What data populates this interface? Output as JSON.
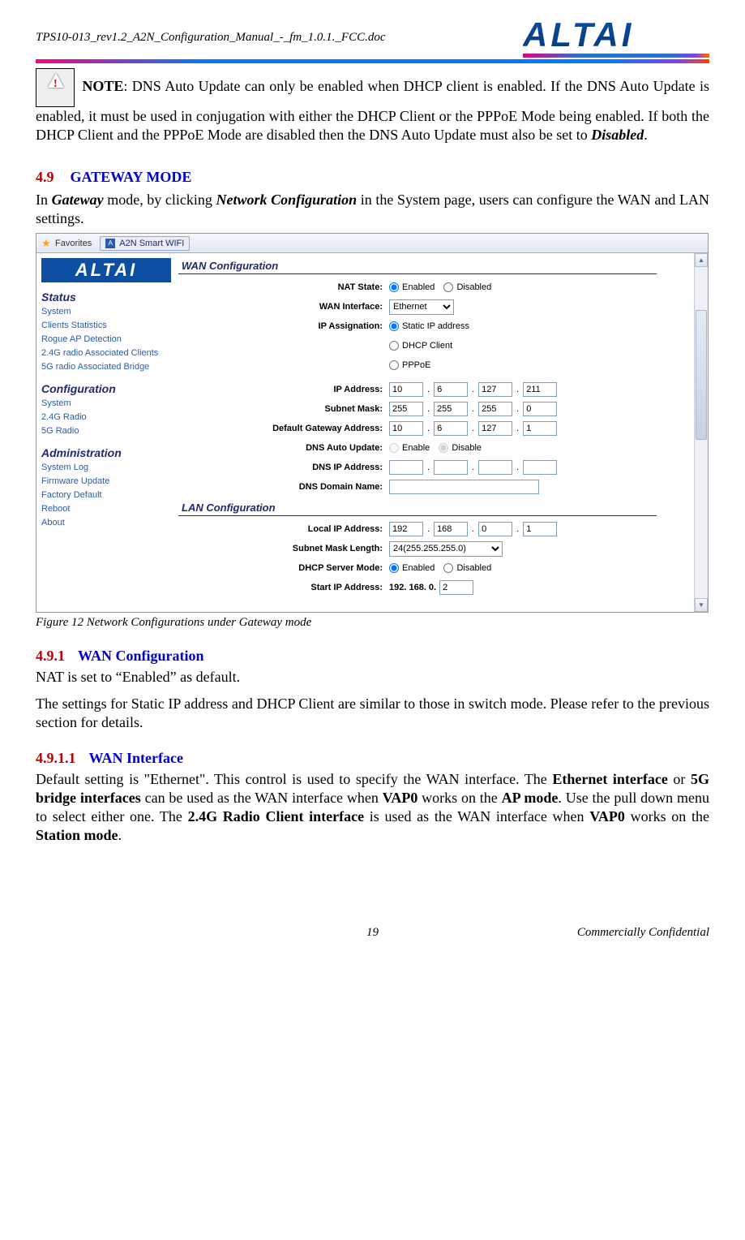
{
  "header": {
    "doc_id": "TPS10-013_rev1.2_A2N_Configuration_Manual_-_fm_1.0.1._FCC.doc",
    "logo_text": "ALTAI"
  },
  "note": {
    "label": "NOTE",
    "text1": ": DNS Auto Update can only be enabled when DHCP client is enabled. If the DNS Auto Update is enabled, it must be used in conjugation with either the DHCP Client or the PPPoE Mode being enabled. If both the DHCP Client and the PPPoE Mode are disabled then the DNS Auto Update must also be set to ",
    "disabled_word": "Disabled",
    "period": "."
  },
  "sec49": {
    "num": "4.9",
    "title": "GATEWAY MODE",
    "intro_a": "In ",
    "intro_b": "Gateway",
    "intro_c": " mode, by clicking ",
    "intro_d": "Network Configuration",
    "intro_e": " in the System page, users can configure the WAN and LAN settings."
  },
  "screenshot": {
    "favorites": "Favorites",
    "tab_title": "A2N Smart WIFI",
    "logo": "ALTAI",
    "sidebar": {
      "status_head": "Status",
      "status_items": [
        "System",
        "Clients Statistics",
        "Rogue AP Detection",
        "2.4G radio Associated Clients",
        "5G radio Associated Bridge"
      ],
      "config_head": "Configuration",
      "config_items": [
        "System",
        "2.4G Radio",
        "5G Radio"
      ],
      "admin_head": "Administration",
      "admin_items": [
        "System Log",
        "Firmware Update",
        "Factory Default",
        "Reboot",
        "About"
      ]
    },
    "wan": {
      "heading": "WAN Configuration",
      "nat_label": "NAT State:",
      "nat_enabled": "Enabled",
      "nat_disabled": "Disabled",
      "wan_if_label": "WAN Interface:",
      "wan_if_value": "Ethernet",
      "ip_assign_label": "IP Assignation:",
      "ip_opt1": "Static IP address",
      "ip_opt2": "DHCP Client",
      "ip_opt3": "PPPoE",
      "ip_addr_label": "IP Address:",
      "ip_addr": [
        "10",
        "6",
        "127",
        "211"
      ],
      "subnet_label": "Subnet Mask:",
      "subnet": [
        "255",
        "255",
        "255",
        "0"
      ],
      "gw_label": "Default Gateway Address:",
      "gw": [
        "10",
        "6",
        "127",
        "1"
      ],
      "dns_auto_label": "DNS Auto Update:",
      "dns_enable": "Enable",
      "dns_disable": "Disable",
      "dns_ip_label": "DNS IP Address:",
      "dns_ip": [
        "",
        "",
        "",
        ""
      ],
      "dns_domain_label": "DNS Domain Name:",
      "dns_domain": ""
    },
    "lan": {
      "heading": "LAN Configuration",
      "local_ip_label": "Local IP Address:",
      "local_ip": [
        "192",
        "168",
        "0",
        "1"
      ],
      "sml_label": "Subnet Mask Length:",
      "sml_value": "24(255.255.255.0)",
      "dhcp_mode_label": "DHCP Server Mode:",
      "dhcp_enabled": "Enabled",
      "dhcp_disabled": "Disabled",
      "start_ip_label": "Start IP Address:",
      "start_ip_prefix": "192. 168. 0.",
      "start_ip_last": "2",
      "cut_label": ""
    }
  },
  "figure_caption": "Figure 12     Network Configurations under Gateway mode",
  "sec491": {
    "num": "4.9.1",
    "title": "WAN Configuration",
    "p1": "NAT is set to “Enabled” as default.",
    "p2": "The settings for Static IP address and DHCP Client are similar to those in switch mode. Please refer to the previous section for details."
  },
  "sec4911": {
    "num": "4.9.1.1",
    "title": "WAN Interface",
    "p_a": "Default setting is \"Ethernet\". This control is used to specify the WAN interface. The ",
    "p_b": "Ethernet interface",
    "p_c": " or ",
    "p_d": "5G bridge interfaces",
    "p_e": " can be used as the WAN interface when ",
    "p_f": "VAP0",
    "p_g": " works on the ",
    "p_h": "AP mode",
    "p_i": ". Use the pull down menu to select either one. The ",
    "p_j": "2.4G Radio Client interface",
    "p_k": " is used as the WAN interface when ",
    "p_l": "VAP0",
    "p_m": " works on the ",
    "p_n": "Station mode",
    "p_o": "."
  },
  "footer": {
    "page": "19",
    "conf": "Commercially Confidential"
  }
}
